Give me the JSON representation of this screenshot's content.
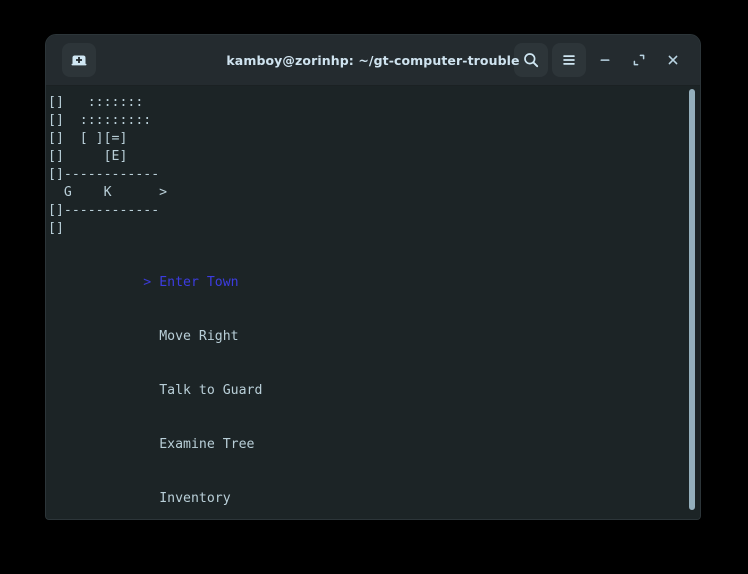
{
  "window": {
    "title": "kamboy@zorinhp: ~/gt-computer-trouble",
    "bg_color": "#1c2426",
    "titlebar_color": "#242b2f"
  },
  "titlebar": {
    "new_tab_label": "New Tab",
    "search_label": "Search",
    "menu_label": "Menu",
    "minimize_label": "Minimize",
    "maximize_label": "Maximize",
    "close_label": "Close"
  },
  "terminal": {
    "fg_color": "#b9cfd8",
    "ascii_art": "[]   :::::::\n[]  :::::::::\n[]  [ ][=]\n[]     [E]\n[]------------\n  G    K      >\n[]------------\n[]",
    "menu_items": [
      {
        "caret": ">",
        "label": "Enter Town",
        "selected": true
      },
      {
        "caret": " ",
        "label": "Move Right",
        "selected": false
      },
      {
        "caret": " ",
        "label": "Talk to Guard",
        "selected": false
      },
      {
        "caret": " ",
        "label": "Examine Tree",
        "selected": false
      },
      {
        "caret": " ",
        "label": "Inventory",
        "selected": false
      }
    ],
    "selected_color": "#3c3ce0",
    "caret_color": "#3b3bd4"
  },
  "scrollbar": {
    "thumb_color": "#94afbc"
  }
}
